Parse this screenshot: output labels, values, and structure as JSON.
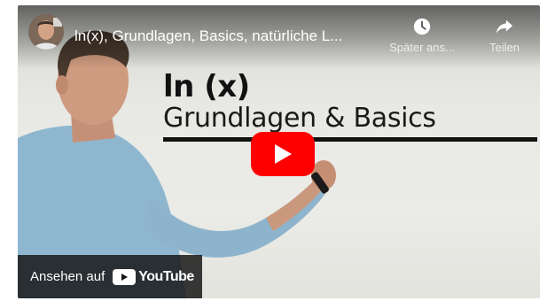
{
  "video": {
    "title": "ln(x), Grundlagen, Basics, natürliche L...",
    "board_title": "ln (x)",
    "board_subtitle": "Grundlagen & Basics"
  },
  "actions": {
    "watch_later_label": "Später ans...",
    "share_label": "Teilen"
  },
  "footer": {
    "watch_on_label": "Ansehen auf",
    "brand": "YouTube"
  },
  "icons": [
    "channel-avatar",
    "clock-icon",
    "share-arrow-icon",
    "play-icon",
    "youtube-logo-icon"
  ],
  "colors": {
    "play_button": "#ff0000",
    "overlay": "#171717"
  }
}
